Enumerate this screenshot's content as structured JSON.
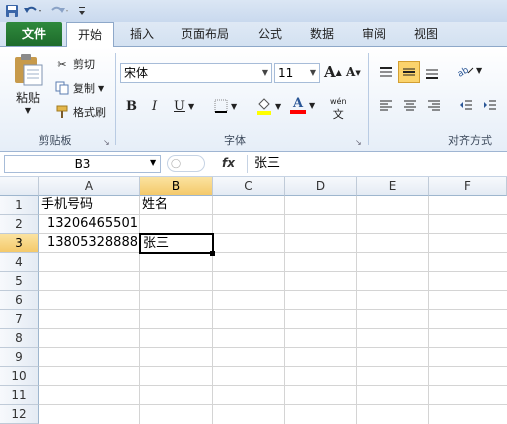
{
  "quick_access": {
    "save_icon": "save-icon",
    "undo_icon": "undo-icon",
    "redo_icon": "redo-icon",
    "customize_icon": "customize-qat-icon"
  },
  "tabs": [
    "文件",
    "开始",
    "插入",
    "页面布局",
    "公式",
    "数据",
    "审阅",
    "视图"
  ],
  "ribbon": {
    "clipboard": {
      "paste": "粘贴",
      "cut": "剪切",
      "copy": "复制",
      "format_painter": "格式刷",
      "group_label": "剪贴板"
    },
    "font": {
      "font_name": "宋体",
      "font_size": "11",
      "bold": "B",
      "italic": "I",
      "underline": "U",
      "grow": "A",
      "shrink": "A",
      "font_color": "A",
      "phonetic": "wén",
      "group_label": "字体"
    },
    "alignment": {
      "group_label": "对齐方式"
    }
  },
  "formula_bar": {
    "name_box": "B3",
    "fx": "fx",
    "content": "张三"
  },
  "sheet": {
    "columns": [
      "A",
      "B",
      "C",
      "D",
      "E",
      "F"
    ],
    "rows": [
      "1",
      "2",
      "3",
      "4",
      "5",
      "6",
      "7",
      "8",
      "9",
      "10",
      "11",
      "12"
    ],
    "cells": {
      "A1": "手机号码",
      "B1": "姓名",
      "A2": "13206465501",
      "A3": "13805328888",
      "B3": "张三"
    },
    "active_cell": "B3"
  },
  "colors": {
    "file_tab": "#1e6b2b",
    "selected_header": "#f4c96a",
    "highlight": "#ffff00",
    "font_color_bar": "#ff0000"
  }
}
